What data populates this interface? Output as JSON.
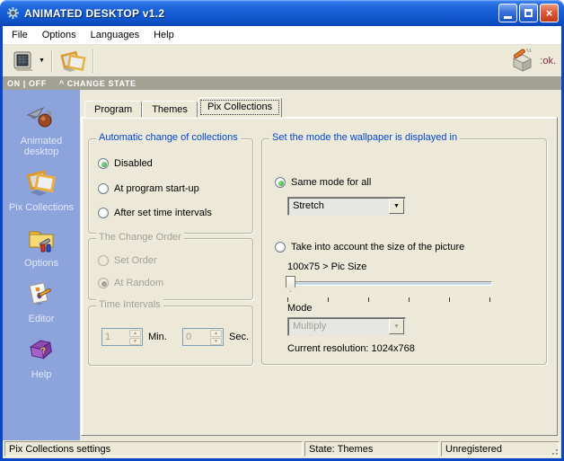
{
  "window": {
    "title": "ANIMATED DESKTOP v1.2"
  },
  "menu": {
    "items": [
      "File",
      "Options",
      "Languages",
      "Help"
    ]
  },
  "toolbar": {
    "ok_text": ":ok."
  },
  "strip": {
    "on_off": "ON | OFF",
    "change_state": "^ CHANGE STATE"
  },
  "sidebar": {
    "items": [
      "Animated desktop",
      "Pix Collections",
      "Options",
      "Editor",
      "Help"
    ]
  },
  "tabs": [
    "Program",
    "Themes",
    "Pix Collections"
  ],
  "active_tab": "Pix Collections",
  "panels": {
    "auto_change": {
      "title": "Automatic change of collections",
      "options": [
        "Disabled",
        "At program start-up",
        "After set time intervals"
      ],
      "selected": "Disabled"
    },
    "change_order": {
      "title": "The Change Order",
      "options": [
        "Set Order",
        "At Random"
      ],
      "selected": "At Random",
      "disabled": true
    },
    "time_intervals": {
      "title": "Time Intervals",
      "min_value": "1",
      "min_label": "Min.",
      "sec_value": "0",
      "sec_label": "Sec.",
      "disabled": true
    },
    "display_mode": {
      "title": "Set the mode the wallpaper is displayed in",
      "same_mode_label": "Same mode for all",
      "same_mode_value": "Stretch",
      "size_label": "Take into account the size of the picture",
      "pic_size_label": "100x75 > Pic Size",
      "mode_label": "Mode",
      "mode_value": "Multiply",
      "mode_disabled": true,
      "resolution_label": "Current resolution: 1024x768",
      "selected": "Same mode for all"
    }
  },
  "status": {
    "left": "Pix Collections settings",
    "middle": "State: Themes",
    "right": "Unregistered"
  },
  "glyphs": {
    "dropdown_arrow": "▼",
    "spin_up": "▲",
    "spin_down": "▼",
    "close": "×"
  },
  "colors": {
    "titlebar_blue": "#1a60d6",
    "sidebar_blue": "#8CA3DC",
    "panel_bg": "#ECE9D8",
    "group_title_blue": "#0046D5",
    "radio_green": "#2e9e2e",
    "disabled_gray": "#A3A198",
    "strip_gray": "#A3A193",
    "ok_maroon": "#8B2742"
  }
}
